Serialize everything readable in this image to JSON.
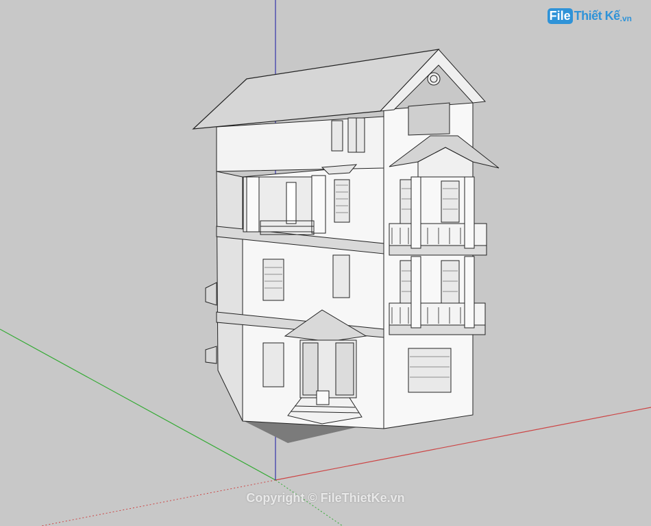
{
  "logo": {
    "part1": "File",
    "part2": "Thiết Kế",
    "suffix": ".vn"
  },
  "watermark": "Copyright © FileThietKe.vn",
  "colors": {
    "background": "#c8c8c8",
    "axis_red": "#c44",
    "axis_green": "#3a3",
    "axis_blue": "#33a",
    "wall_light": "#f7f7f7",
    "wall_side": "#e6e6e6",
    "roof": "#d6d6d6",
    "shadow": "#7b7b7b"
  }
}
